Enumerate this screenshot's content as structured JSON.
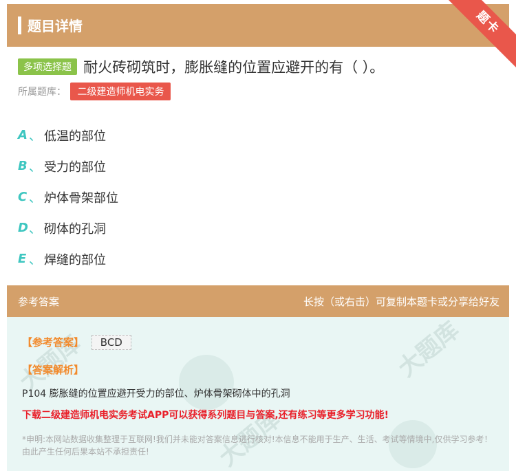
{
  "header": {
    "title": "题目详情",
    "ribbon": "题卡"
  },
  "question": {
    "type_badge": "多项选择题",
    "text": "耐火砖砌筑时，膨胀缝的位置应避开的有（ ）。",
    "bank_label": "所属题库：",
    "bank_name": "二级建造师机电实务"
  },
  "options": [
    {
      "letter": "A",
      "sep": "、",
      "text": "低温的部位"
    },
    {
      "letter": "B",
      "sep": "、",
      "text": "受力的部位"
    },
    {
      "letter": "C",
      "sep": "、",
      "text": "炉体骨架部位"
    },
    {
      "letter": "D",
      "sep": "、",
      "text": "砌体的孔洞"
    },
    {
      "letter": "E",
      "sep": "、",
      "text": "焊缝的部位"
    }
  ],
  "answer_section": {
    "title": "参考答案",
    "hint": "长按（或右击）可复制本题卡或分享给好友",
    "answer_label": "【参考答案】",
    "answer_value": "BCD",
    "analysis_label": "【答案解析】",
    "analysis_text": "P104 膨胀缝的位置应避开受力的部位、炉体骨架砌体中的孔洞",
    "promo": "下载二级建造师机电实务考试APP可以获得系列题目与答案,还有练习等更多学习功能!",
    "disclaimer": "*申明:本网站数据收集整理于互联网!我们并未能对答案信息进行核对!本信息不能用于生产、生活、考试等情境中,仅供学习参考！由此产生任何后果本站不承担责任!"
  },
  "colors": {
    "header_bg": "#d4a06a",
    "ribbon": "#e9574b",
    "type_badge": "#8bc34a",
    "option_letter": "#3ec6c0",
    "answer_bg": "#e9f6f4",
    "answer_label": "#f28a2c",
    "promo": "#e9202a"
  }
}
